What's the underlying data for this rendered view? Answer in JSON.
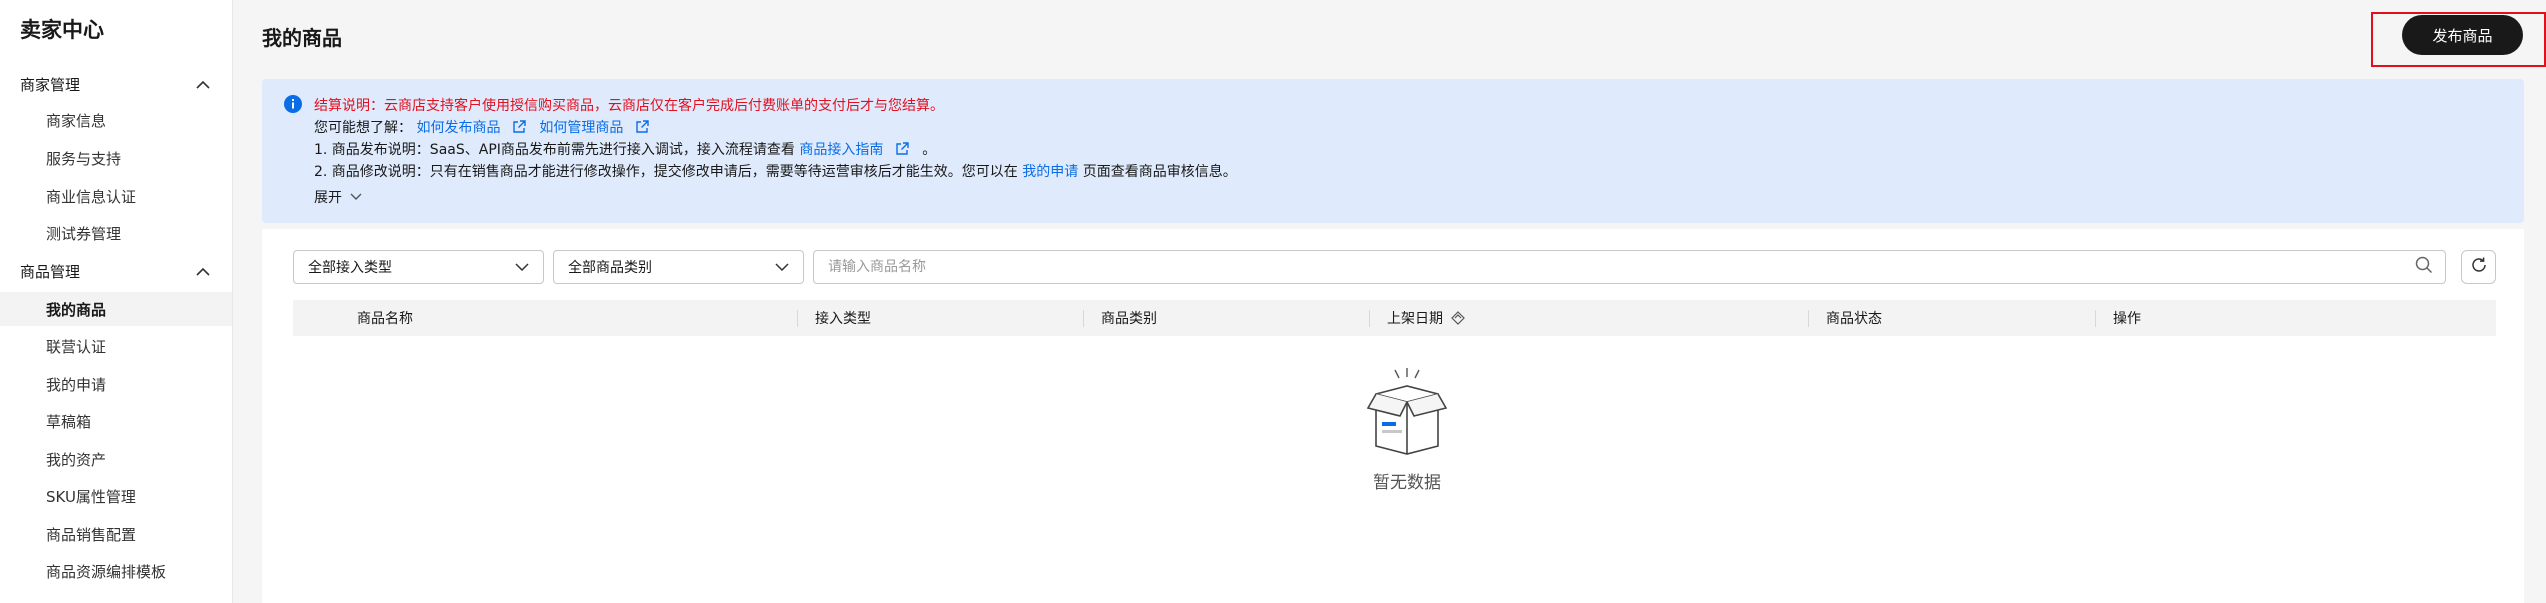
{
  "sidebar": {
    "title": "卖家中心",
    "groups": [
      {
        "label": "商家管理",
        "items": [
          "商家信息",
          "服务与支持",
          "商业信息认证",
          "测试券管理"
        ]
      },
      {
        "label": "商品管理",
        "items": [
          "我的商品",
          "联营认证",
          "我的申请",
          "草稿箱",
          "我的资产",
          "SKU属性管理",
          "商品销售配置",
          "商品资源编排模板"
        ]
      }
    ],
    "active_item": "我的商品"
  },
  "header": {
    "title": "我的商品",
    "publish_label": "发布商品"
  },
  "notice": {
    "settlement": "结算说明：云商店支持客户使用授信购买商品，云商店仅在客户完成后付费账单的支付后才与您结算。",
    "maybe_prefix": "您可能想了解：",
    "link_publish": "如何发布商品",
    "link_manage": "如何管理商品",
    "line1_prefix": "1. 商品发布说明：SaaS、API商品发布前需先进行接入调试，接入流程请查看",
    "line1_link": "商品接入指南",
    "line1_suffix": "。",
    "line2_prefix": "2. 商品修改说明：只有在销售商品才能进行修改操作，提交修改申请后，需要等待运营审核后才能生效。您可以在",
    "line2_link": "我的申请",
    "line2_suffix": "页面查看商品审核信息。",
    "expand_label": "展开"
  },
  "filters": {
    "access_type": "全部接入类型",
    "category": "全部商品类别",
    "search_placeholder": "请输入商品名称"
  },
  "table": {
    "columns": [
      "商品名称",
      "接入类型",
      "商品类别",
      "上架日期",
      "商品状态",
      "操作"
    ],
    "empty_text": "暂无数据"
  },
  "colors": {
    "accent_link": "#0a6de5",
    "warning_red": "#e0101f",
    "notice_bg": "#dfeafc",
    "primary_button": "#191919"
  }
}
